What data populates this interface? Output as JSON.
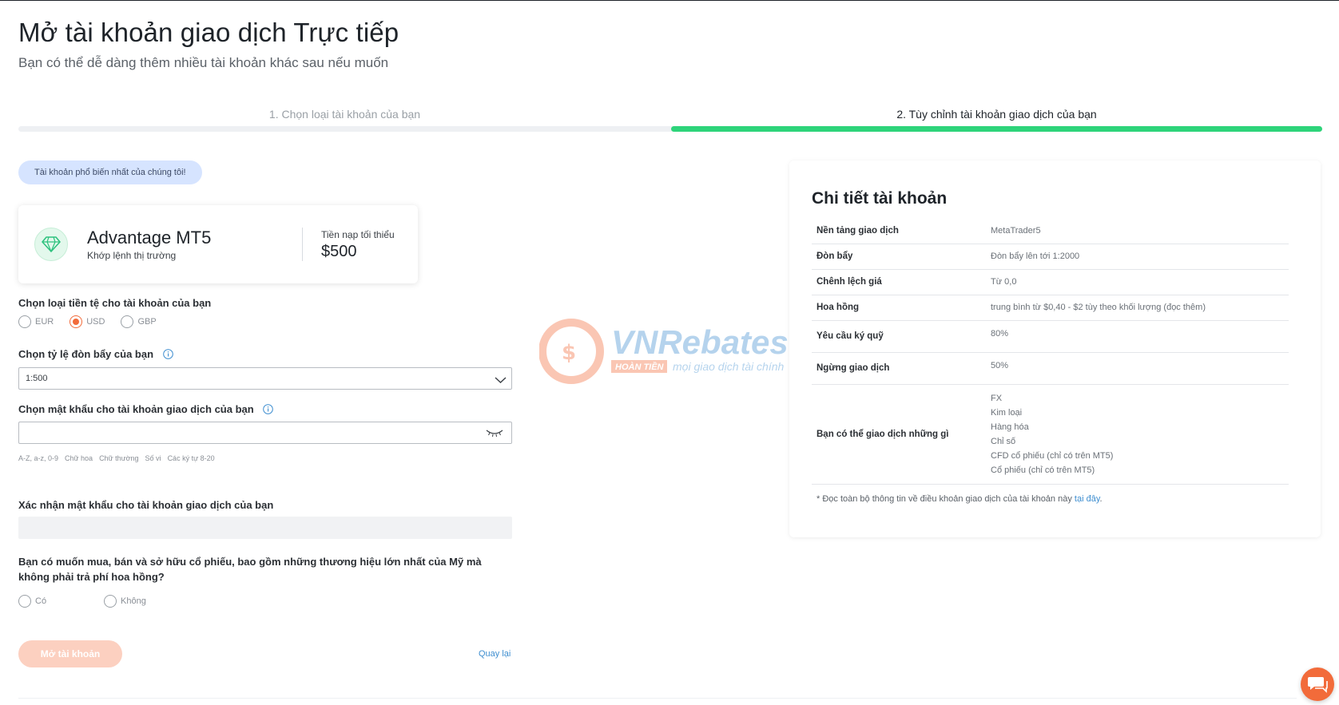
{
  "header": {
    "title": "Mở tài khoản giao dịch Trực tiếp",
    "subtitle": "Bạn có thể dễ dàng thêm nhiều tài khoản khác sau nếu muốn"
  },
  "steps": [
    {
      "label": "1. Chọn loại tài khoản của bạn",
      "active": false
    },
    {
      "label": "2. Tùy chỉnh tài khoản giao dịch của bạn",
      "active": true
    }
  ],
  "progress": {
    "completed_steps": 2,
    "total_steps": 2,
    "accent_color": "#2ed47a"
  },
  "popular_badge": "Tài khoản phổ biến nhất của chúng tôi!",
  "account": {
    "icon": "diamond-icon",
    "name": "Advantage MT5",
    "execution": "Khớp lệnh thị trường",
    "min_deposit_label": "Tiền nạp tối thiểu",
    "min_deposit_value": "$500"
  },
  "currency": {
    "label": "Chọn loại tiền tệ cho tài khoản của bạn",
    "options": [
      "EUR",
      "USD",
      "GBP"
    ],
    "selected": "USD"
  },
  "leverage": {
    "label": "Chọn tỷ lệ đòn bẩy của bạn",
    "value": "1:500"
  },
  "password": {
    "label": "Chọn mật khẩu cho tài khoản giao dịch của bạn",
    "value": "",
    "hints": [
      "A-Z, a-z, 0-9",
      "Chữ hoa",
      "Chữ thường",
      "Số vi",
      "Các ký tự 8-20"
    ]
  },
  "confirm_password": {
    "label": "Xác nhận mật khẩu cho tài khoản giao dịch của bạn",
    "value": ""
  },
  "stocks_question": {
    "label": "Bạn có muốn mua, bán và sở hữu cổ phiếu, bao gồm những thương hiệu lớn nhất của Mỹ mà không phải trả phí hoa hồng?",
    "options": [
      "Có",
      "Không"
    ]
  },
  "actions": {
    "open_account": "Mở tài khoản",
    "back": "Quay lại"
  },
  "details": {
    "title": "Chi tiết tài khoản",
    "rows": [
      {
        "key": "Nền tảng giao dịch",
        "value": "MetaTrader5"
      },
      {
        "key": "Đòn bẩy",
        "value": "Đòn bẩy lên tới 1:2000"
      },
      {
        "key": "Chênh lệch giá",
        "value": "Từ 0,0"
      },
      {
        "key": "Hoa hồng",
        "value": "trung bình từ $0,40 - $2 tùy theo khối lượng (đọc thêm)"
      },
      {
        "key": "Yêu cầu ký quỹ",
        "value": "80%"
      },
      {
        "key": "Ngừng giao dịch",
        "value": "50%"
      }
    ],
    "tradable_label": "Bạn có thể giao dịch những gì",
    "tradable": [
      "FX",
      "Kim loại",
      "Hàng hóa",
      "Chỉ số",
      "CFD cổ phiếu (chỉ có trên MT5)",
      "Cổ phiếu (chỉ có trên MT5)"
    ],
    "footnote": "* Đọc toàn bộ thông tin về điều khoản giao dịch của tài khoản này",
    "footnote_link": "tại đây"
  },
  "watermark": {
    "brand": "VNRebates",
    "tag": "HOÀN TIỀN",
    "slogan": "mọi giao dịch tài chính"
  },
  "colors": {
    "accent_orange": "#f26b3a",
    "progress_green": "#2ed47a",
    "badge_blue": "#d6e4ff",
    "link_blue": "#3e8ed0"
  }
}
